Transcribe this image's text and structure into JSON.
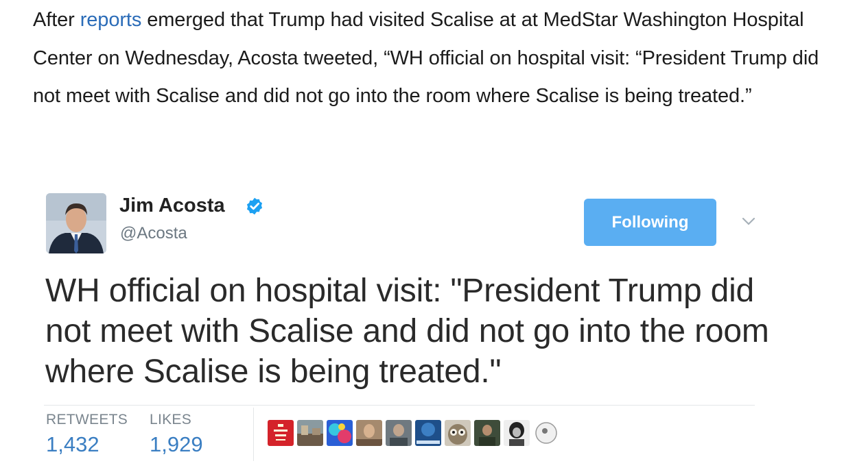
{
  "article": {
    "before_link": "After ",
    "link_text": "reports",
    "after_link": " emerged that Trump had visited Scalise at at MedStar Washington Hospital Center on Wednesday, Acosta tweeted, “WH official on hospital visit: “President Trump did not meet with Scalise and did not go into the room where Scalise is being treated.”"
  },
  "tweet": {
    "author_name": "Jim Acosta",
    "handle": "@Acosta",
    "follow_label": "Following",
    "text": "WH official on hospital visit: \"President Trump did not meet with Scalise and did not go into the room where Scalise is being treated.\"",
    "retweets_label": "RETWEETS",
    "retweets_count": "1,432",
    "likes_label": "LIKES",
    "likes_count": "1,929",
    "colors": {
      "follow_button": "#5aaef2",
      "link": "#2b6cb8",
      "stat_value": "#3a7ec2",
      "verified": "#1da1f2"
    }
  }
}
